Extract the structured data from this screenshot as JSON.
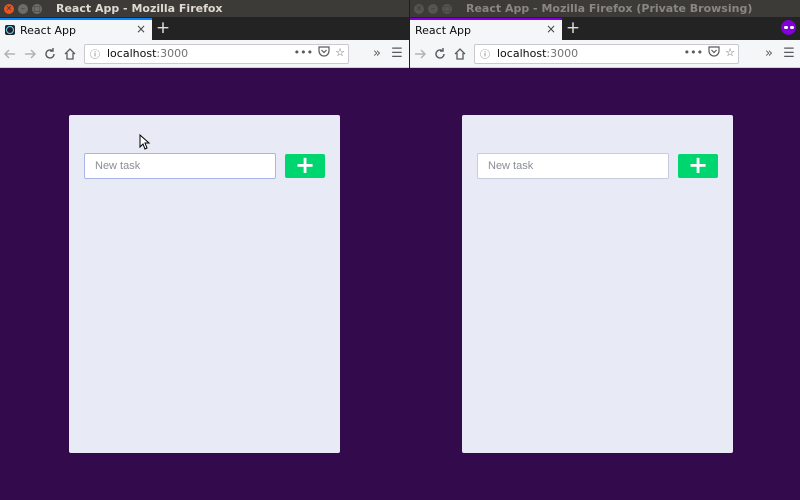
{
  "left_window": {
    "title": "React App - Mozilla Firefox",
    "tab": {
      "label": "React App",
      "close": "×"
    },
    "new_tab": "+",
    "url": {
      "host": "localhost",
      "port": ":3000"
    },
    "task_input": {
      "placeholder": "New task",
      "value": ""
    },
    "add_button": {
      "label": "+"
    }
  },
  "right_window": {
    "title": "React App - Mozilla Firefox (Private Browsing)",
    "tab": {
      "label": "React App",
      "close": "×"
    },
    "new_tab": "+",
    "url": {
      "host": "localhost",
      "port": ":3000"
    },
    "task_input": {
      "placeholder": "New task",
      "value": ""
    },
    "add_button": {
      "label": "+"
    }
  },
  "colors": {
    "desktop_background": "#330a4c",
    "card_background": "#e8eaf6",
    "add_button": "#00d66f",
    "tab_accent": "#0a84ff",
    "private_accent": "#8000d7"
  },
  "icons": {
    "back": "back-arrow-icon",
    "forward": "forward-arrow-icon",
    "reload": "reload-icon",
    "home": "home-icon",
    "info": "info-icon",
    "page_actions": "ellipsis-icon",
    "pocket": "pocket-icon",
    "bookmark": "star-icon",
    "overflow": "chevron-double-right-icon",
    "menu": "hamburger-menu-icon",
    "private": "private-browsing-mask-icon"
  }
}
